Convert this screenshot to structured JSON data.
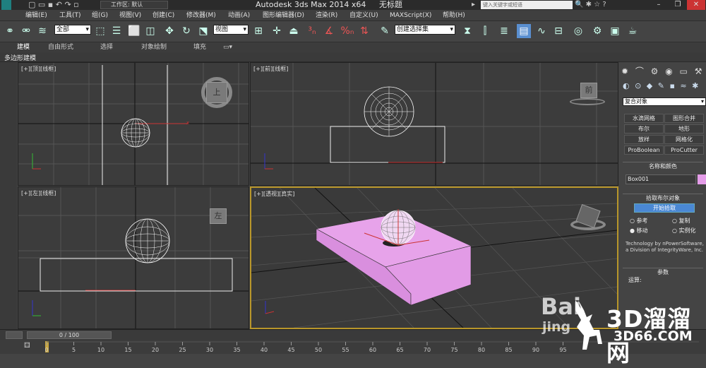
{
  "title": {
    "app": "Autodesk 3ds Max  2014 x64",
    "document": "无标题",
    "workspace": "工作区: 默认",
    "search_placeholder": "键入关键字或短语"
  },
  "menu": [
    "编辑(E)",
    "工具(T)",
    "组(G)",
    "视图(V)",
    "创建(C)",
    "修改器(M)",
    "动画(A)",
    "图形编辑器(D)",
    "渲染(R)",
    "自定义(U)",
    "MAXScript(X)",
    "帮助(H)"
  ],
  "toolbar": {
    "filter": "全部",
    "ref_coord": "视图",
    "named_selection": "创建选择集"
  },
  "ribbon": {
    "tabs": [
      "建模",
      "自由形式",
      "选择",
      "对象绘制",
      "填充"
    ],
    "subtab": "多边形建模"
  },
  "viewports": {
    "top": {
      "label": "[+][顶][线框]",
      "cube": "上"
    },
    "front": {
      "label": "[+][前][线框]",
      "cube": "前"
    },
    "left": {
      "label": "[+][左][线框]",
      "cube": "左"
    },
    "perspective": {
      "label": "[+][透视][真实]"
    }
  },
  "command_panel": {
    "category": "复合对象",
    "object_types": [
      "水滴网格",
      "图形合并",
      "布尔",
      "地形",
      "放样",
      "网格化",
      "ProBoolean",
      "ProCutter"
    ],
    "name_color_title": "名称和颜色",
    "object_name": "Box001",
    "object_color": "#e49ce8",
    "pick_boolean_title": "拾取布尔对象",
    "start_pick": "开始拾取",
    "options": [
      "参考",
      "复制",
      "移动",
      "实例化"
    ],
    "selected_option": "移动",
    "credits": "Technology by nPowerSoftware, a Division of IntegrityWare, Inc.",
    "params_title": "参数",
    "operation_label": "运算:"
  },
  "timeline": {
    "frame": "0 / 100",
    "ticks": [
      "0",
      "5",
      "10",
      "15",
      "20",
      "25",
      "30",
      "35",
      "40",
      "45",
      "50",
      "55",
      "60",
      "65",
      "70",
      "75",
      "80",
      "85",
      "90",
      "95"
    ]
  },
  "watermark": {
    "site": "3D溜溜网",
    "domain": "3D66.COM",
    "baidu": "Bai",
    "baidu_sub": "jing"
  }
}
